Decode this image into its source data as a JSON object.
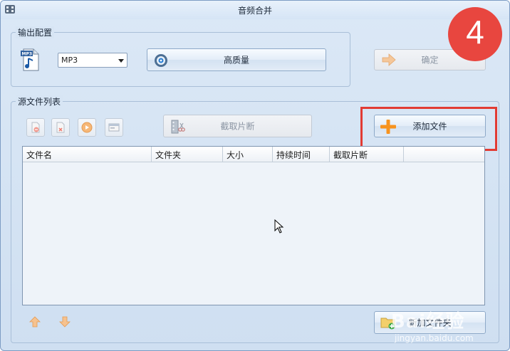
{
  "window": {
    "title": "音频合并"
  },
  "output_group": {
    "label": "输出配置",
    "format_icon_text": "MP3",
    "format_select": {
      "value": "MP3"
    },
    "quality_button": "高质量",
    "ok_button": "确定"
  },
  "source_group": {
    "label": "源文件列表",
    "clip_button": "截取片断",
    "add_button": "添加文件",
    "table": {
      "columns": [
        "文件名",
        "文件夹",
        "大小",
        "持续时间",
        "截取片断",
        ""
      ],
      "rows": []
    },
    "new_button": "新加文件夹"
  },
  "overlay": {
    "step_number": "4",
    "watermark_text": "Bai经验",
    "watermark_url": "jingyan.baidu.com",
    "highlight_color": "#e23b33"
  }
}
